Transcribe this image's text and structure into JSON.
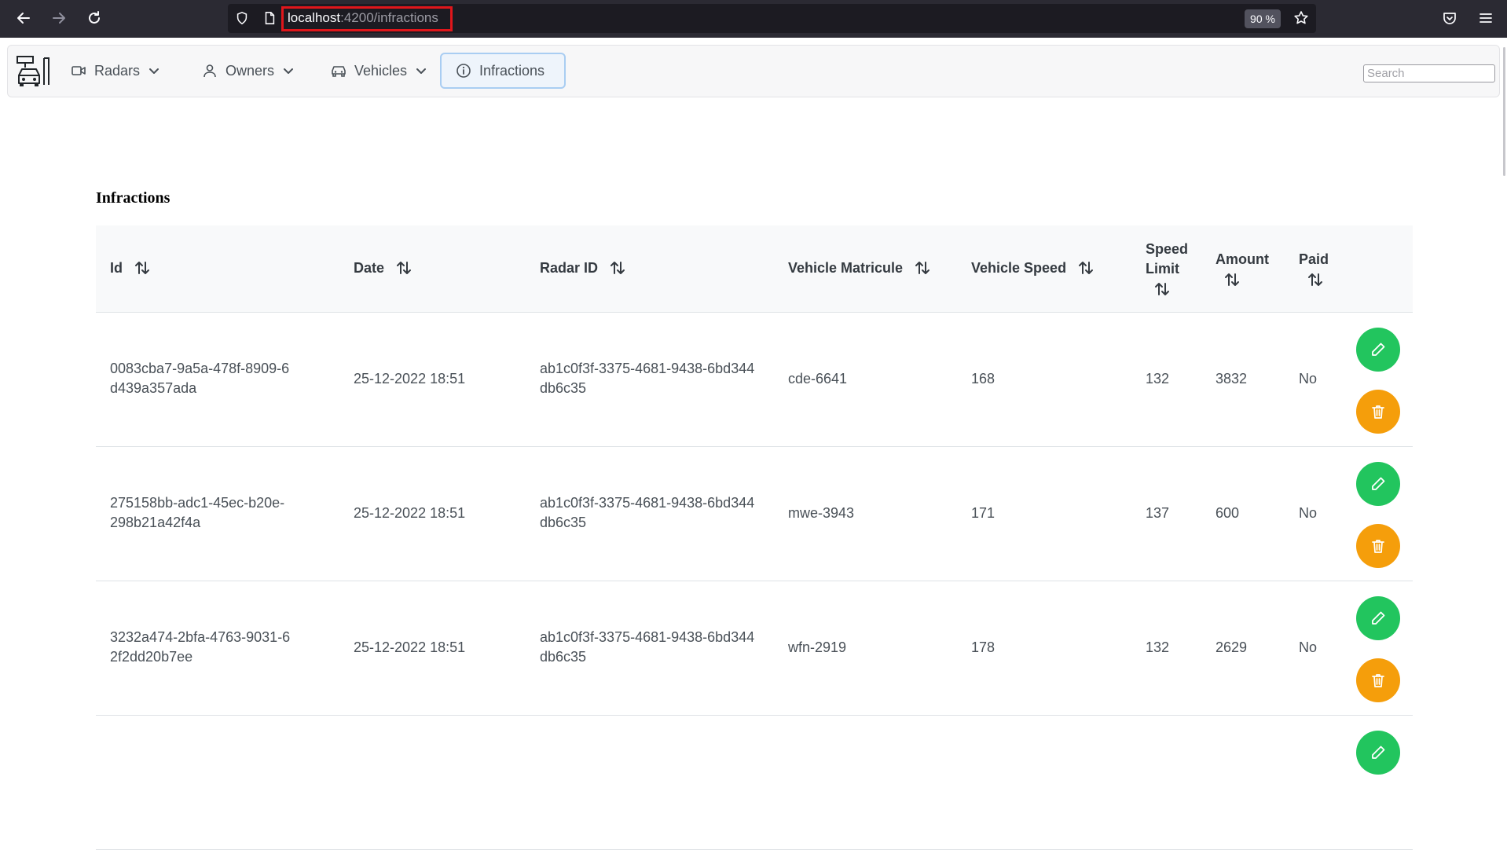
{
  "browser": {
    "url_host": "localhost",
    "url_rest": ":4200/infractions",
    "zoom": "90 %"
  },
  "nav": {
    "items": [
      {
        "label": "Radars"
      },
      {
        "label": "Owners"
      },
      {
        "label": "Vehicles"
      },
      {
        "label": "Infractions"
      }
    ],
    "search_placeholder": "Search"
  },
  "page": {
    "title": "Infractions"
  },
  "table": {
    "headers": {
      "id": "Id",
      "date": "Date",
      "radar_id": "Radar ID",
      "matricule": "Vehicle Matricule",
      "speed": "Vehicle Speed",
      "limit": "Speed\nLimit",
      "amount": "Amount",
      "paid": "Paid"
    },
    "rows": [
      {
        "id": "0083cba7-9a5a-478f-8909-6d439a357ada",
        "date": "25-12-2022 18:51",
        "radar_id": "ab1c0f3f-3375-4681-9438-6bd344db6c35",
        "matricule": "cde-6641",
        "speed": "168",
        "limit": "132",
        "amount": "3832",
        "paid": "No"
      },
      {
        "id": "275158bb-adc1-45ec-b20e-298b21a42f4a",
        "date": "25-12-2022 18:51",
        "radar_id": "ab1c0f3f-3375-4681-9438-6bd344db6c35",
        "matricule": "mwe-3943",
        "speed": "171",
        "limit": "137",
        "amount": "600",
        "paid": "No"
      },
      {
        "id": "3232a474-2bfa-4763-9031-62f2dd20b7ee",
        "date": "25-12-2022 18:51",
        "radar_id": "ab1c0f3f-3375-4681-9438-6bd344db6c35",
        "matricule": "wfn-2919",
        "speed": "178",
        "limit": "132",
        "amount": "2629",
        "paid": "No"
      }
    ]
  },
  "colors": {
    "edit_button": "#22c55e",
    "delete_button": "#f59e0b",
    "url_highlight": "#e0161b"
  }
}
